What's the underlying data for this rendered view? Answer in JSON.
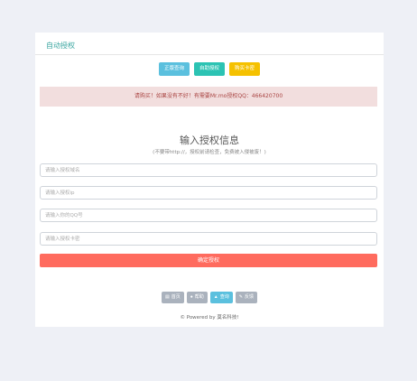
{
  "card": {
    "title": "自动授权"
  },
  "top_buttons": [
    {
      "label": "正版查询",
      "color": "#5bc0de"
    },
    {
      "label": "自助授权",
      "color": "#2cc3b3"
    },
    {
      "label": "购买卡密",
      "color": "#f5c100"
    }
  ],
  "alert": {
    "text": "请购买！如果没有不好！有需要Mr.mo授权QQ：466420700"
  },
  "form": {
    "title": "输入授权信息",
    "subtitle": "(不要带http://，授权前请检查，免费被入侵被废！)",
    "fields": [
      {
        "placeholder": "请输入授权域名",
        "value": ""
      },
      {
        "placeholder": "请输入授权ip",
        "value": ""
      },
      {
        "placeholder": "请输入你的QQ号",
        "value": ""
      },
      {
        "placeholder": "请输入授权卡密",
        "value": ""
      }
    ],
    "submit_label": "确定授权"
  },
  "tools": [
    {
      "icon": "▤",
      "icon_name": "list-icon",
      "label": "首页",
      "active": false
    },
    {
      "icon": "●",
      "icon_name": "info-icon",
      "label": "帮助",
      "active": false
    },
    {
      "icon": "▲",
      "icon_name": "user-icon",
      "label": "查询",
      "active": true
    },
    {
      "icon": "✎",
      "icon_name": "pencil-icon",
      "label": "反馈",
      "active": false
    }
  ],
  "footer": {
    "text": "© Powered by 莫名科技!"
  },
  "colors": {
    "accent": "#3aa6a0",
    "submit": "#ff6b5e",
    "alert_bg": "#f2dede",
    "alert_text": "#a94442"
  }
}
